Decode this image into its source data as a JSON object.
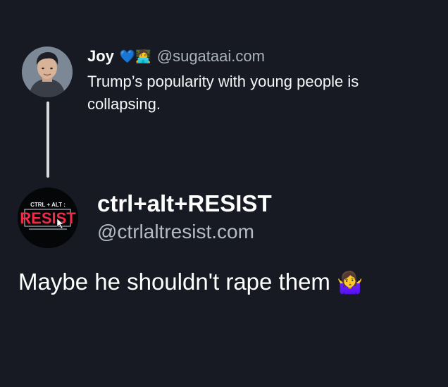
{
  "post": {
    "author_name": "Joy",
    "author_emoji": "💙🧑‍💻",
    "author_handle": "@sugataai.com",
    "text": "Trump’s popularity with young people is collapsing."
  },
  "reply": {
    "author_name": "ctrl+alt+RESIST",
    "author_handle": "@ctrlaltresist.com",
    "text": "Maybe he shouldn't rape them",
    "emoji": "🤷‍♀️",
    "avatar": {
      "logo_line1": "CTRL + ALT :",
      "logo_line2": "RESIST"
    }
  },
  "colors": {
    "background": "#171a22",
    "primary_text": "#ffffff",
    "secondary_text": "#aab2bc",
    "thread_line": "#d7dade"
  }
}
